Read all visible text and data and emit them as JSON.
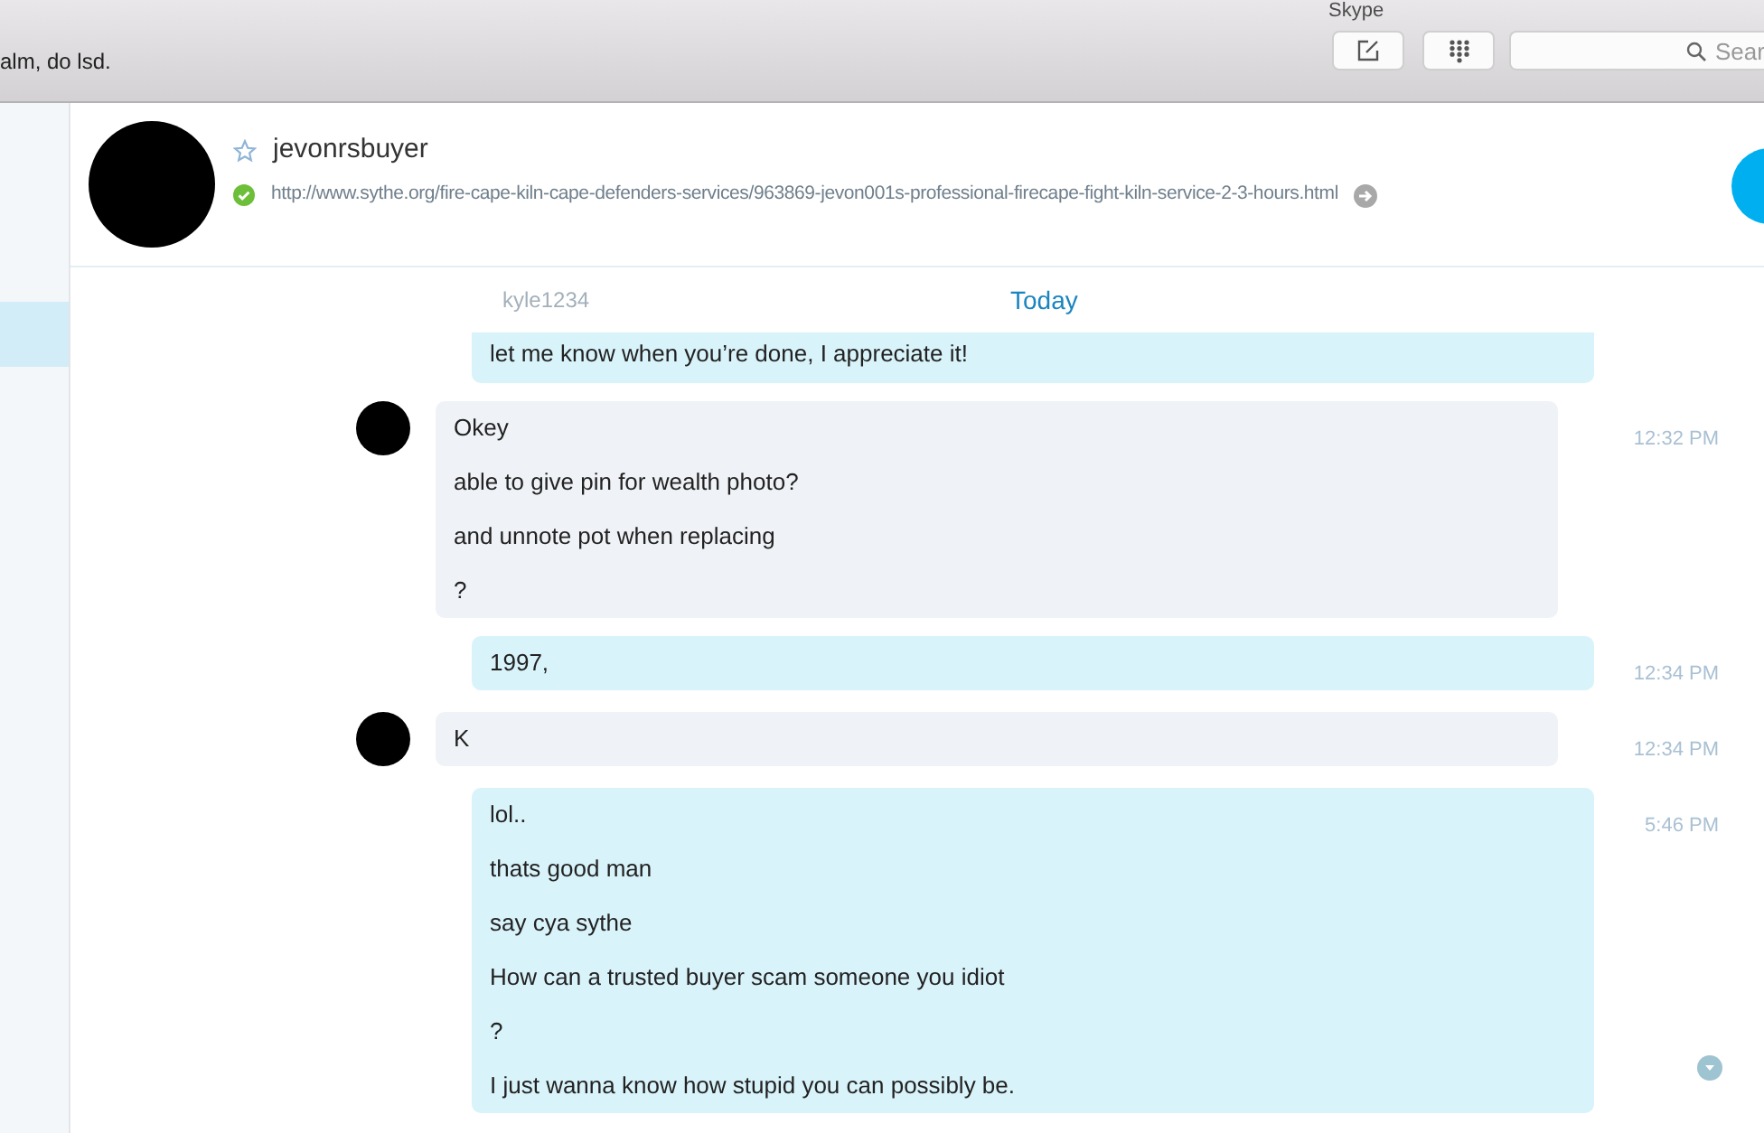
{
  "window": {
    "title": "Skype"
  },
  "toolbar": {
    "status_text": "alm, do lsd.",
    "search": {
      "placeholder": "Sear"
    }
  },
  "sidebar": {
    "items": [
      {
        "selected": true
      }
    ]
  },
  "contact": {
    "name": "jevonrsbuyer",
    "favorite": false,
    "online": true,
    "mood": "http://www.sythe.org/fire-cape-kiln-cape-defenders-services/963869-jevon001s-professional-firecape-fight-kiln-service-2-3-hours.html"
  },
  "date_bar": {
    "sender": "kyle1234",
    "label": "Today"
  },
  "messages": [
    {
      "kind": "own",
      "lines": [
        "let me know when you’re done, I appreciate it!"
      ]
    },
    {
      "kind": "their",
      "time": "12:32 PM",
      "lines": [
        "Okey",
        "able to give pin for wealth photo?",
        "and unnote pot when replacing",
        "?"
      ]
    },
    {
      "kind": "own",
      "time": "12:34 PM",
      "lines": [
        "1997,"
      ]
    },
    {
      "kind": "their",
      "time": "12:34 PM",
      "lines": [
        "K"
      ]
    },
    {
      "kind": "own",
      "time": "5:46 PM",
      "lines": [
        "lol..",
        "thats good man",
        "say cya sythe",
        "How can a trusted buyer scam someone you idiot",
        "?",
        "I just wanna know how stupid you can possibly be."
      ]
    }
  ]
}
